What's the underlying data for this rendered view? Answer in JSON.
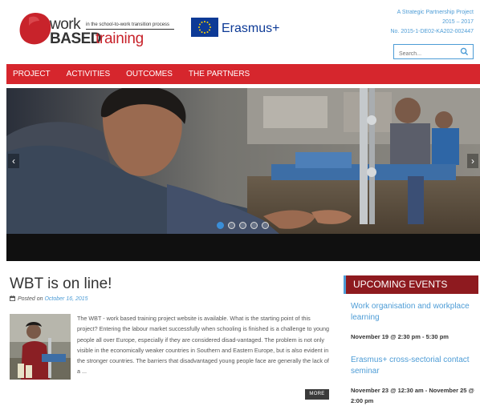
{
  "logo": {
    "word1": "work",
    "tagline": "in the school-to-work transition process",
    "word2": "BASED",
    "word3": "training"
  },
  "erasmus": {
    "label": "Erasmus+"
  },
  "partnership": {
    "line1": "A Strategic Partnership Project",
    "line2": "2015 – 2017",
    "line3": "No. 2015-1-DE02-KA202-002447"
  },
  "search": {
    "placeholder": "Search..."
  },
  "nav": {
    "items": [
      {
        "label": "PROJECT"
      },
      {
        "label": "ACTIVITIES"
      },
      {
        "label": "OUTCOMES"
      },
      {
        "label": "THE PARTNERS"
      }
    ]
  },
  "slider": {
    "slide_count": 5,
    "active_slide": 1
  },
  "post": {
    "title": "WBT is on line!",
    "posted_on": "Posted on",
    "date": "October 16, 2015",
    "body": "The WBT - work based training project website is available. What is the starting point of this project? Entering the labour market successfully when schooling is finished is a challenge to young people all over Europe, especially if they are considered disad-vantaged. The problem is not only visible in the economically weaker countries in Southern and Eastern Europe, but is also evident in the stronger countries. The barriers that disadvantaged young people face are generally the lack of a ...",
    "more_label": "MORE"
  },
  "events": {
    "heading": "UPCOMING EVENTS",
    "items": [
      {
        "title": "Work organisation and workplace learning",
        "when": "November 19 @ 2:30 pm - 5:30 pm"
      },
      {
        "title": "Erasmus+ cross-sectorial contact seminar",
        "when": "November 23 @ 12:30 am - November 25 @ 2:00 pm"
      }
    ]
  },
  "colors": {
    "brand_red": "#d6262d",
    "events_red": "#8e1a1f",
    "link_blue": "#4d9cd6",
    "eu_blue": "#0d3a96"
  }
}
